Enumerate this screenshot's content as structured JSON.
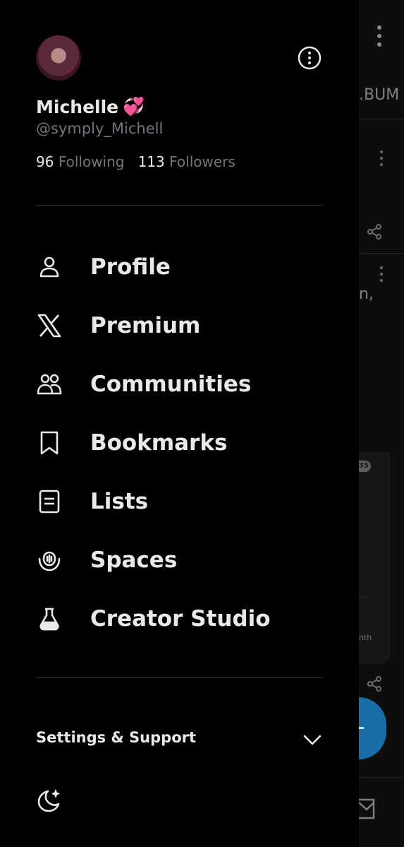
{
  "background": {
    "tab_text": ".BUM",
    "tweet_text": "n,",
    "badge": "35",
    "small_text": "nth"
  },
  "profile": {
    "name": "Michelle",
    "name_emoji": "💞",
    "handle": "@symply_Michell",
    "following_count": "96",
    "following_label": "Following",
    "followers_count": "113",
    "followers_label": "Followers"
  },
  "nav": {
    "items": [
      {
        "label": "Profile",
        "icon": "person-icon"
      },
      {
        "label": "Premium",
        "icon": "x-logo-icon"
      },
      {
        "label": "Communities",
        "icon": "communities-icon"
      },
      {
        "label": "Bookmarks",
        "icon": "bookmark-icon"
      },
      {
        "label": "Lists",
        "icon": "list-icon"
      },
      {
        "label": "Spaces",
        "icon": "spaces-icon"
      },
      {
        "label": "Creator Studio",
        "icon": "flask-icon"
      }
    ]
  },
  "settings": {
    "label": "Settings & Support"
  },
  "colors": {
    "background": "#000000",
    "text_primary": "#e7e9ea",
    "text_secondary": "#71767b",
    "divider": "#2f3336",
    "fab": "#1a6ea8"
  }
}
